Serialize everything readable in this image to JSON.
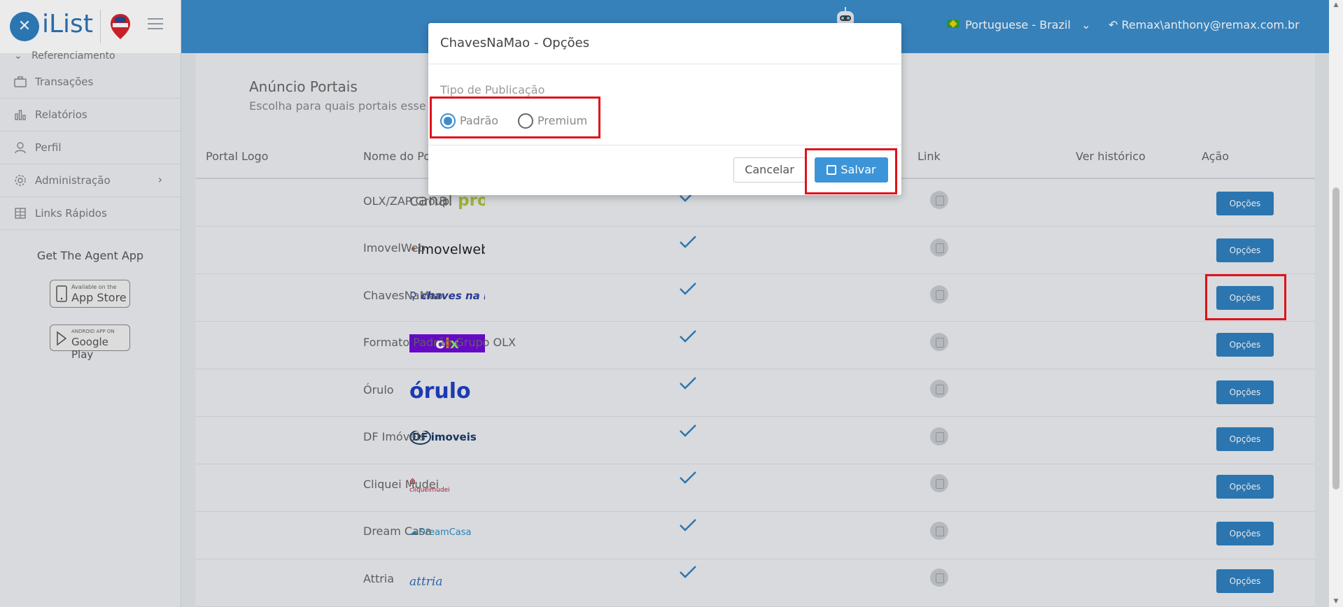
{
  "header": {
    "logo_text": "iList",
    "language": "Portuguese - Brazil",
    "user": "Remax\\anthony@remax.com.br",
    "brand_color": "#3c8dcb"
  },
  "sidebar": {
    "prev_item": "Referenciamento",
    "items": [
      {
        "label": "Transações",
        "icon": "briefcase-icon"
      },
      {
        "label": "Relatórios",
        "icon": "bar-chart-icon"
      },
      {
        "label": "Perfil",
        "icon": "user-icon"
      },
      {
        "label": "Administração",
        "icon": "gear-icon"
      },
      {
        "label": "Links Rápidos",
        "icon": "building-icon"
      }
    ],
    "agent_title": "Get The Agent App",
    "app_store_small": "Available on the",
    "app_store_big": "App Store",
    "google_play_small": "ANDROID APP ON",
    "google_play_big": "Google Play"
  },
  "main": {
    "title": "Anúncio Portais",
    "subtitle": "Escolha para quais portais esse i",
    "columns": {
      "logo": "Portal Logo",
      "name": "Nome do Po",
      "link": "Link",
      "history": "Ver histórico",
      "action": "Ação"
    },
    "option_label": "Opções",
    "rows": [
      {
        "logo": "canal pro",
        "name": "OLX/ZAP Group"
      },
      {
        "logo": "imovelweb",
        "name": "ImovelWeb"
      },
      {
        "logo": "chaves na mão",
        "name": "ChavesNaMao"
      },
      {
        "logo": "olx",
        "name": "Formato Padrão Grupo OLX"
      },
      {
        "logo": "órulo",
        "name": "Órulo"
      },
      {
        "logo": "DFimoveis",
        "name": "DF Imóveis"
      },
      {
        "logo": "cliqueimudei",
        "name": "Cliquei Mudei"
      },
      {
        "logo": "DreamCasa",
        "name": "Dream Casa"
      },
      {
        "logo": "attria",
        "name": "Attria"
      }
    ]
  },
  "modal": {
    "title": "ChavesNaMao - Opções",
    "label": "Tipo de Publicação",
    "option_padrao": "Padrão",
    "option_premium": "Premium",
    "selected": "Padrão",
    "cancel_label": "Cancelar",
    "save_label": "Salvar"
  }
}
